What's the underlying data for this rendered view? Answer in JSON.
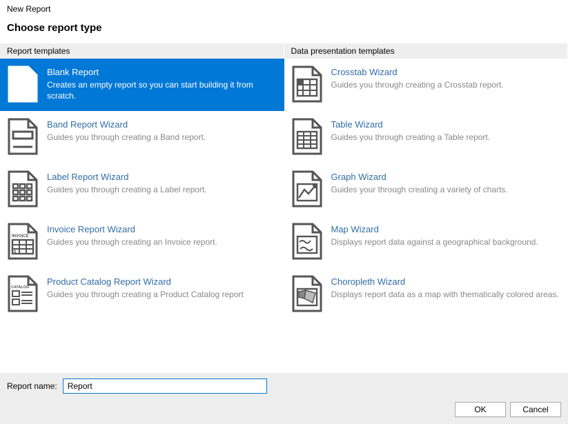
{
  "window_title": "New Report",
  "page_title": "Choose report type",
  "columns": {
    "left_header": "Report templates",
    "right_header": "Data presentation templates"
  },
  "left_items": [
    {
      "title": "Blank Report",
      "desc": "Creates an empty report so you can start building it from scratch.",
      "selected": true
    },
    {
      "title": "Band Report Wizard",
      "desc": "Guides you through creating a Band report."
    },
    {
      "title": "Label Report Wizard",
      "desc": "Guides you through creating a Label report."
    },
    {
      "title": "Invoice Report Wizard",
      "desc": "Guides you through creating an Invoice report."
    },
    {
      "title": "Product Catalog Report Wizard",
      "desc": "Guides you through creating a Product Catalog report"
    }
  ],
  "right_items": [
    {
      "title": "Crosstab Wizard",
      "desc": "Guides you through creating a Crosstab report."
    },
    {
      "title": "Table Wizard",
      "desc": "Guides you through creating a Table report."
    },
    {
      "title": "Graph Wizard",
      "desc": "Guides your through creating a variety of charts."
    },
    {
      "title": "Map Wizard",
      "desc": "Displays report data against a geographical background."
    },
    {
      "title": "Choropleth Wizard",
      "desc": "Displays report data as a map with thematically colored areas."
    }
  ],
  "footer": {
    "name_label": "Report name:",
    "name_value": "Report",
    "ok": "OK",
    "cancel": "Cancel"
  },
  "colors": {
    "selection": "#0078d7",
    "link": "#316da6",
    "muted": "#888888",
    "panel": "#eeeeee"
  }
}
